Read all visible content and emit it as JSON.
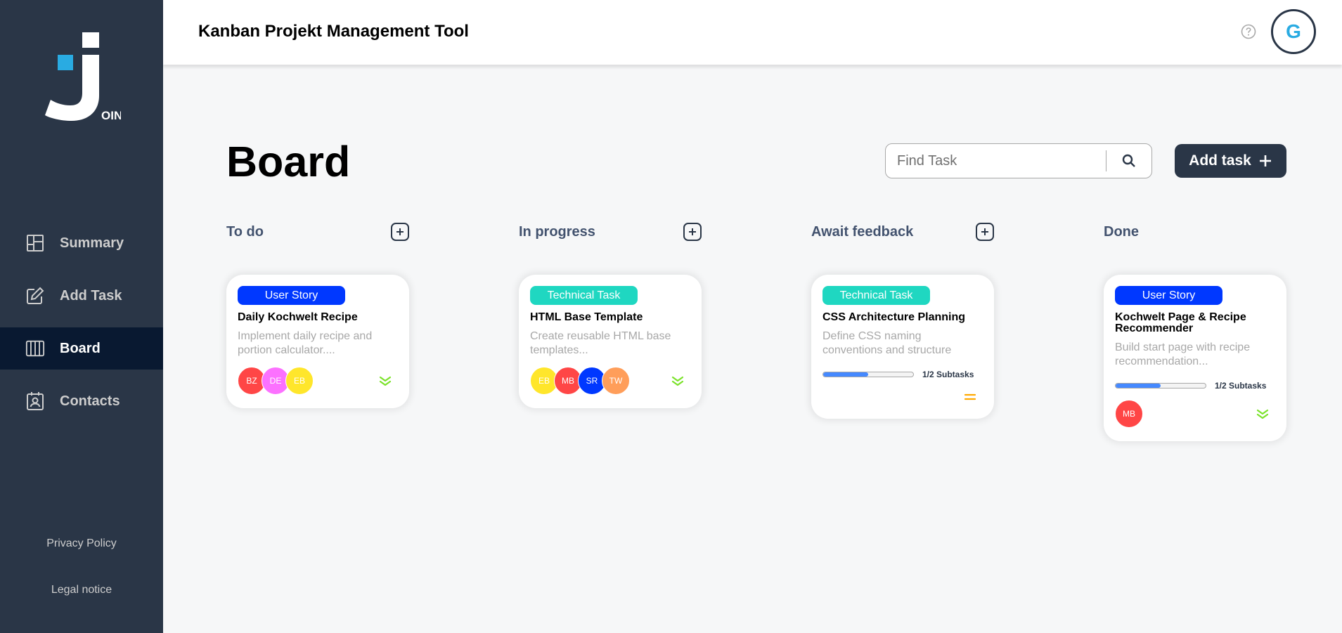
{
  "app": {
    "header_title": "Kanban Projekt Management Tool",
    "user_initial": "G",
    "logo_text": "OIN"
  },
  "sidebar": {
    "items": [
      {
        "label": "Summary",
        "icon": "summary-icon",
        "active": false
      },
      {
        "label": "Add Task",
        "icon": "add-task-icon",
        "active": false
      },
      {
        "label": "Board",
        "icon": "board-icon",
        "active": true
      },
      {
        "label": "Contacts",
        "icon": "contacts-icon",
        "active": false
      }
    ],
    "privacy_policy": "Privacy Policy",
    "legal_notice": "Legal notice"
  },
  "board": {
    "title": "Board",
    "search_placeholder": "Find Task",
    "add_task_label": "Add task",
    "columns": [
      {
        "title": "To do",
        "card": {
          "category": "User Story",
          "category_color": "#0038ff",
          "title": "Daily Kochwelt Recipe",
          "description": "Implement daily recipe and portion calculator....",
          "subtasks": null,
          "assignees": [
            {
              "initials": "BZ",
              "color": "#ff4646"
            },
            {
              "initials": "DE",
              "color": "#fc71ff"
            },
            {
              "initials": "EB",
              "color": "#ffe62b"
            }
          ],
          "priority": "low"
        }
      },
      {
        "title": "In progress",
        "card": {
          "category": "Technical Task",
          "category_color": "#1fd7c1",
          "title": "HTML Base Template",
          "description": "Create reusable HTML base templates...",
          "subtasks": null,
          "assignees": [
            {
              "initials": "EB",
              "color": "#ffe62b"
            },
            {
              "initials": "MB",
              "color": "#ff4646"
            },
            {
              "initials": "SR",
              "color": "#0038ff"
            },
            {
              "initials": "TW",
              "color": "#ff9e5a"
            }
          ],
          "priority": "low"
        }
      },
      {
        "title": "Await feedback",
        "card": {
          "category": "Technical Task",
          "category_color": "#1fd7c1",
          "title": "CSS Architecture Planning",
          "description": "Define CSS naming conventions and structure",
          "subtasks": {
            "text": "1/2 Subtasks",
            "done": 1,
            "total": 2
          },
          "assignees": [],
          "priority": "medium"
        }
      },
      {
        "title": "Done",
        "card": {
          "category": "User Story",
          "category_color": "#0038ff",
          "title": "Kochwelt Page & Recipe Recommender",
          "description": "Build start page with recipe recommendation...",
          "subtasks": {
            "text": "1/2 Subtasks",
            "done": 1,
            "total": 2
          },
          "assignees": [
            {
              "initials": "MB",
              "color": "#ff4646"
            }
          ],
          "priority": "low"
        }
      }
    ]
  },
  "colors": {
    "sidebar_bg": "#2a3647",
    "active_nav_bg": "#091931",
    "accent": "#29abe2",
    "progress_fill": "#4589ff",
    "priority_low": "#7ae229",
    "priority_medium": "#ffa800"
  }
}
